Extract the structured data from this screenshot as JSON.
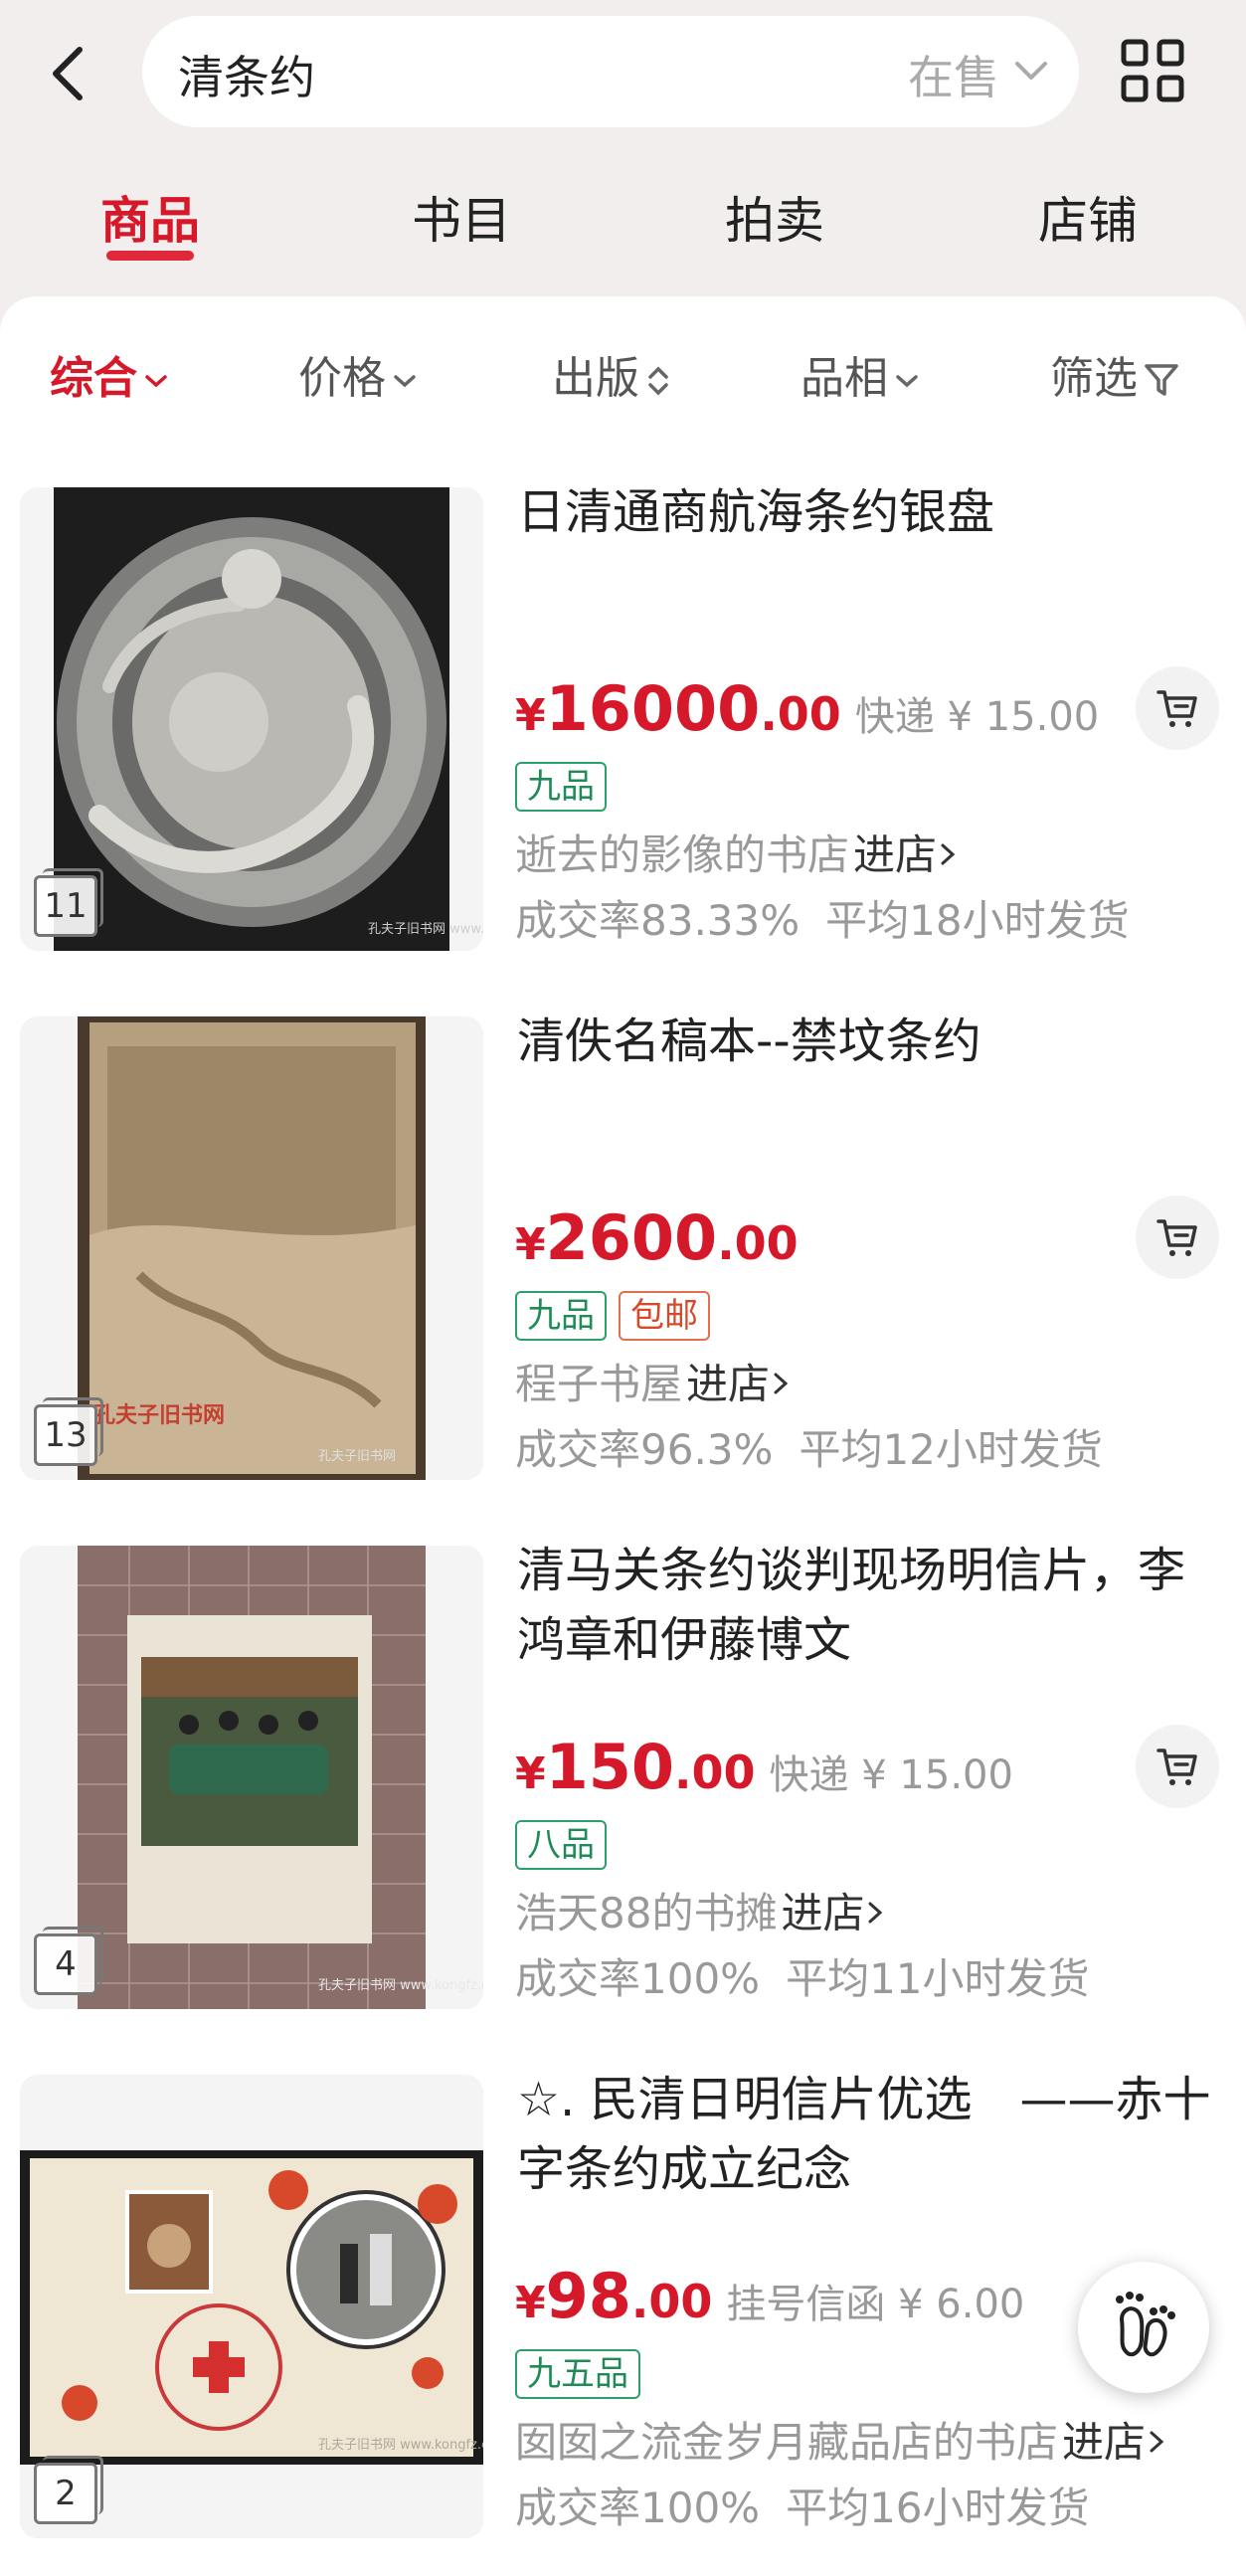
{
  "search": {
    "query": "清条约",
    "status": "在售"
  },
  "tabs": [
    {
      "label": "商品"
    },
    {
      "label": "书目"
    },
    {
      "label": "拍卖"
    },
    {
      "label": "店铺"
    }
  ],
  "filters": [
    {
      "label": "综合"
    },
    {
      "label": "价格"
    },
    {
      "label": "出版"
    },
    {
      "label": "品相"
    },
    {
      "label": "筛选"
    }
  ],
  "enter_label": "进店",
  "currency": "¥",
  "items": [
    {
      "title": "日清通商航海条约银盘",
      "price_int": "16000",
      "price_dec": ".00",
      "shipping": "快递 ¥ 15.00",
      "tags": [
        "九品"
      ],
      "shop": "逝去的影像的书店",
      "rate": "成交率83.33%",
      "ship_time": "平均18小时发货",
      "img_count": "11",
      "watermark": "孔夫子旧书网 www.kongfz.com"
    },
    {
      "title": "清佚名稿本--禁坟条约",
      "price_int": "2600",
      "price_dec": ".00",
      "shipping": "",
      "tags": [
        "九品",
        "包邮"
      ],
      "shop": "程子书屋",
      "rate": "成交率96.3%",
      "ship_time": "平均12小时发货",
      "img_count": "13",
      "watermark": "孔夫子旧书网"
    },
    {
      "title": "清马关条约谈判现场明信片，李鸿章和伊藤博文",
      "price_int": "150",
      "price_dec": ".00",
      "shipping": "快递 ¥ 15.00",
      "tags": [
        "八品"
      ],
      "shop": "浩天88的书摊",
      "rate": "成交率100%",
      "ship_time": "平均11小时发货",
      "img_count": "4",
      "watermark": "孔夫子旧书网 www.kongfz.com"
    },
    {
      "title": "☆. 民清日明信片优选　——赤十字条约成立纪念",
      "price_int": "98",
      "price_dec": ".00",
      "shipping": "挂号信函 ¥ 6.00",
      "tags": [
        "九五品"
      ],
      "shop": "囡囡之流金岁月藏品店的书店",
      "rate": "成交率100%",
      "ship_time": "平均16小时发货",
      "img_count": "2",
      "watermark": "孔夫子旧书网 www.kongfz.com"
    }
  ],
  "colors": {
    "accent": "#d6182b",
    "tag_green": "#1f8b57",
    "tag_red": "#d64a2a",
    "background": "#f3eeee"
  }
}
